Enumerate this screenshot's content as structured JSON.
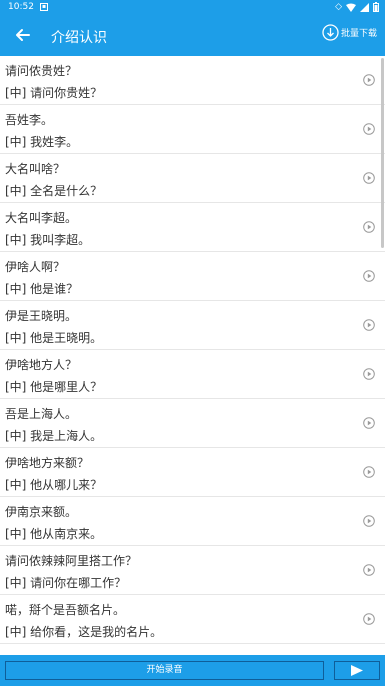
{
  "status_bar": {
    "time": "10:52",
    "notification_icon": "app-notification-icon",
    "vibrate_icon": "vibrate-icon",
    "wifi_icon": "wifi-icon",
    "signal_icon": "signal-icon",
    "battery_icon": "battery-icon"
  },
  "app_bar": {
    "title": "介绍认识",
    "back_icon": "arrow-left-icon",
    "batch_download_label": "批量下载",
    "batch_download_icon": "download-circle-icon"
  },
  "rows": [
    {
      "dialect": "请问侬贵姓？",
      "mandarin": "[中] 请问你贵姓？"
    },
    {
      "dialect": "吾姓李。",
      "mandarin": "[中] 我姓李。"
    },
    {
      "dialect": "大名叫啥？",
      "mandarin": "[中] 全名是什么？"
    },
    {
      "dialect": "大名叫李超。",
      "mandarin": "[中] 我叫李超。"
    },
    {
      "dialect": "伊啥人啊？",
      "mandarin": "[中] 他是谁？"
    },
    {
      "dialect": "伊是王晓明。",
      "mandarin": "[中] 他是王晓明。"
    },
    {
      "dialect": "伊啥地方人？",
      "mandarin": "[中] 他是哪里人？"
    },
    {
      "dialect": "吾是上海人。",
      "mandarin": "[中] 我是上海人。"
    },
    {
      "dialect": "伊啥地方来额？",
      "mandarin": "[中] 他从哪儿来？"
    },
    {
      "dialect": "伊南京来额。",
      "mandarin": "[中] 他从南京来。"
    },
    {
      "dialect": "请问侬辣辣阿里搭工作？",
      "mandarin": "[中] 请问你在哪工作？"
    },
    {
      "dialect": "喏，搿个是吾额名片。",
      "mandarin": "[中] 给你看，这是我的名片。"
    }
  ],
  "bottom_bar": {
    "record_label": "开始录音",
    "play_all_icon": "play-triangle-icon"
  },
  "colors": {
    "primary": "#1d9ee8",
    "divider": "#e6e6e6",
    "text": "#333333",
    "play_icon": "#9a9a9a"
  }
}
